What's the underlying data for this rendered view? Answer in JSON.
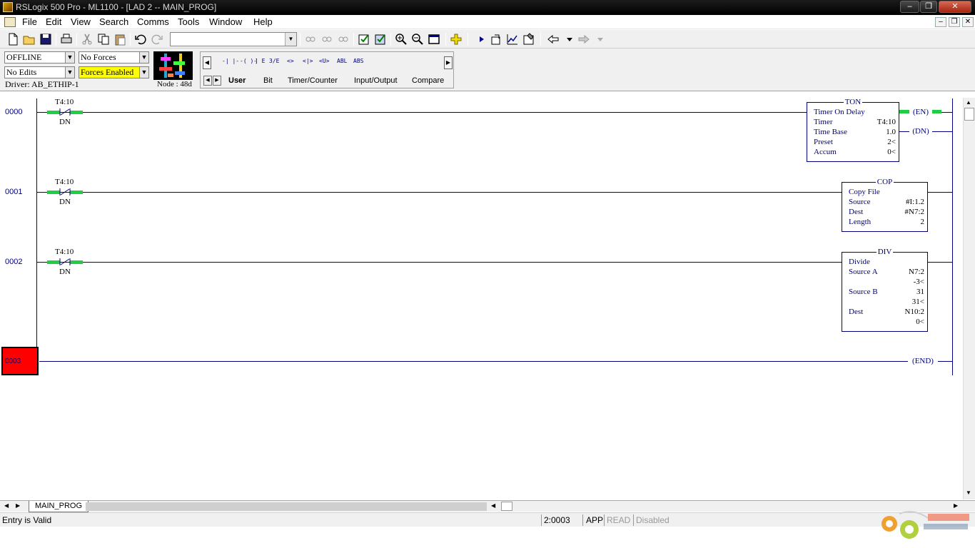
{
  "window": {
    "title": "RSLogix 500 Pro - ML1100 - [LAD 2 -- MAIN_PROG]",
    "minimize": "–",
    "maximize": "❐",
    "close": "✕"
  },
  "menu": {
    "items": [
      "File",
      "Edit",
      "View",
      "Search",
      "Comms",
      "Tools",
      "Window",
      "Help"
    ]
  },
  "toolbar": {
    "combo_value": ""
  },
  "status": {
    "mode": "OFFLINE",
    "forces": "No Forces",
    "edits": "No Edits",
    "forces_enabled": "Forces Enabled",
    "driver": "Driver: AB_ETHIP-1",
    "node": "Node : 48d"
  },
  "palette": {
    "instructions": [
      "-| |-",
      "-( )-",
      "] E",
      "3/E",
      "<>",
      "<|>",
      "<U>",
      "ABL",
      "ABS"
    ],
    "tabs": [
      "User",
      "Bit",
      "Timer/Counter",
      "Input/Output",
      "Compare"
    ]
  },
  "rungs": [
    {
      "number": "0000",
      "contact": {
        "address": "T4:10",
        "bit": "DN"
      },
      "box": {
        "title": "TON",
        "rows": [
          {
            "label": "Timer On Delay",
            "value": ""
          },
          {
            "label": "Timer",
            "value": "T4:10"
          },
          {
            "label": "Time Base",
            "value": "1.0"
          },
          {
            "label": "Preset",
            "value": "2<"
          },
          {
            "label": "Accum",
            "value": "0<"
          }
        ]
      },
      "coils": [
        "EN",
        "DN"
      ]
    },
    {
      "number": "0001",
      "contact": {
        "address": "T4:10",
        "bit": "DN"
      },
      "box": {
        "title": "COP",
        "rows": [
          {
            "label": "Copy File",
            "value": ""
          },
          {
            "label": "Source",
            "value": "#I:1.2"
          },
          {
            "label": "Dest",
            "value": "#N7:2"
          },
          {
            "label": "Length",
            "value": "2"
          }
        ]
      }
    },
    {
      "number": "0002",
      "contact": {
        "address": "T4:10",
        "bit": "DN"
      },
      "box": {
        "title": "DIV",
        "rows": [
          {
            "label": "Divide",
            "value": ""
          },
          {
            "label": "Source A",
            "value": "N7:2"
          },
          {
            "label": "",
            "value": "-3<"
          },
          {
            "label": "Source B",
            "value": "31"
          },
          {
            "label": "",
            "value": "31<"
          },
          {
            "label": "Dest",
            "value": "N10:2"
          },
          {
            "label": "",
            "value": "0<"
          }
        ]
      }
    },
    {
      "number": "0003",
      "end": "END"
    }
  ],
  "bottom": {
    "file_tab": "MAIN_PROG"
  },
  "statusbar": {
    "message": "Entry is Valid",
    "position": "2:0003",
    "app": "APP",
    "read": "READ",
    "disabled": "Disabled"
  },
  "colors": {
    "rail": "#000080",
    "energized": "#22cc44",
    "selected_rung": "#ff0000",
    "forces_enabled_bg": "#ffff00"
  }
}
